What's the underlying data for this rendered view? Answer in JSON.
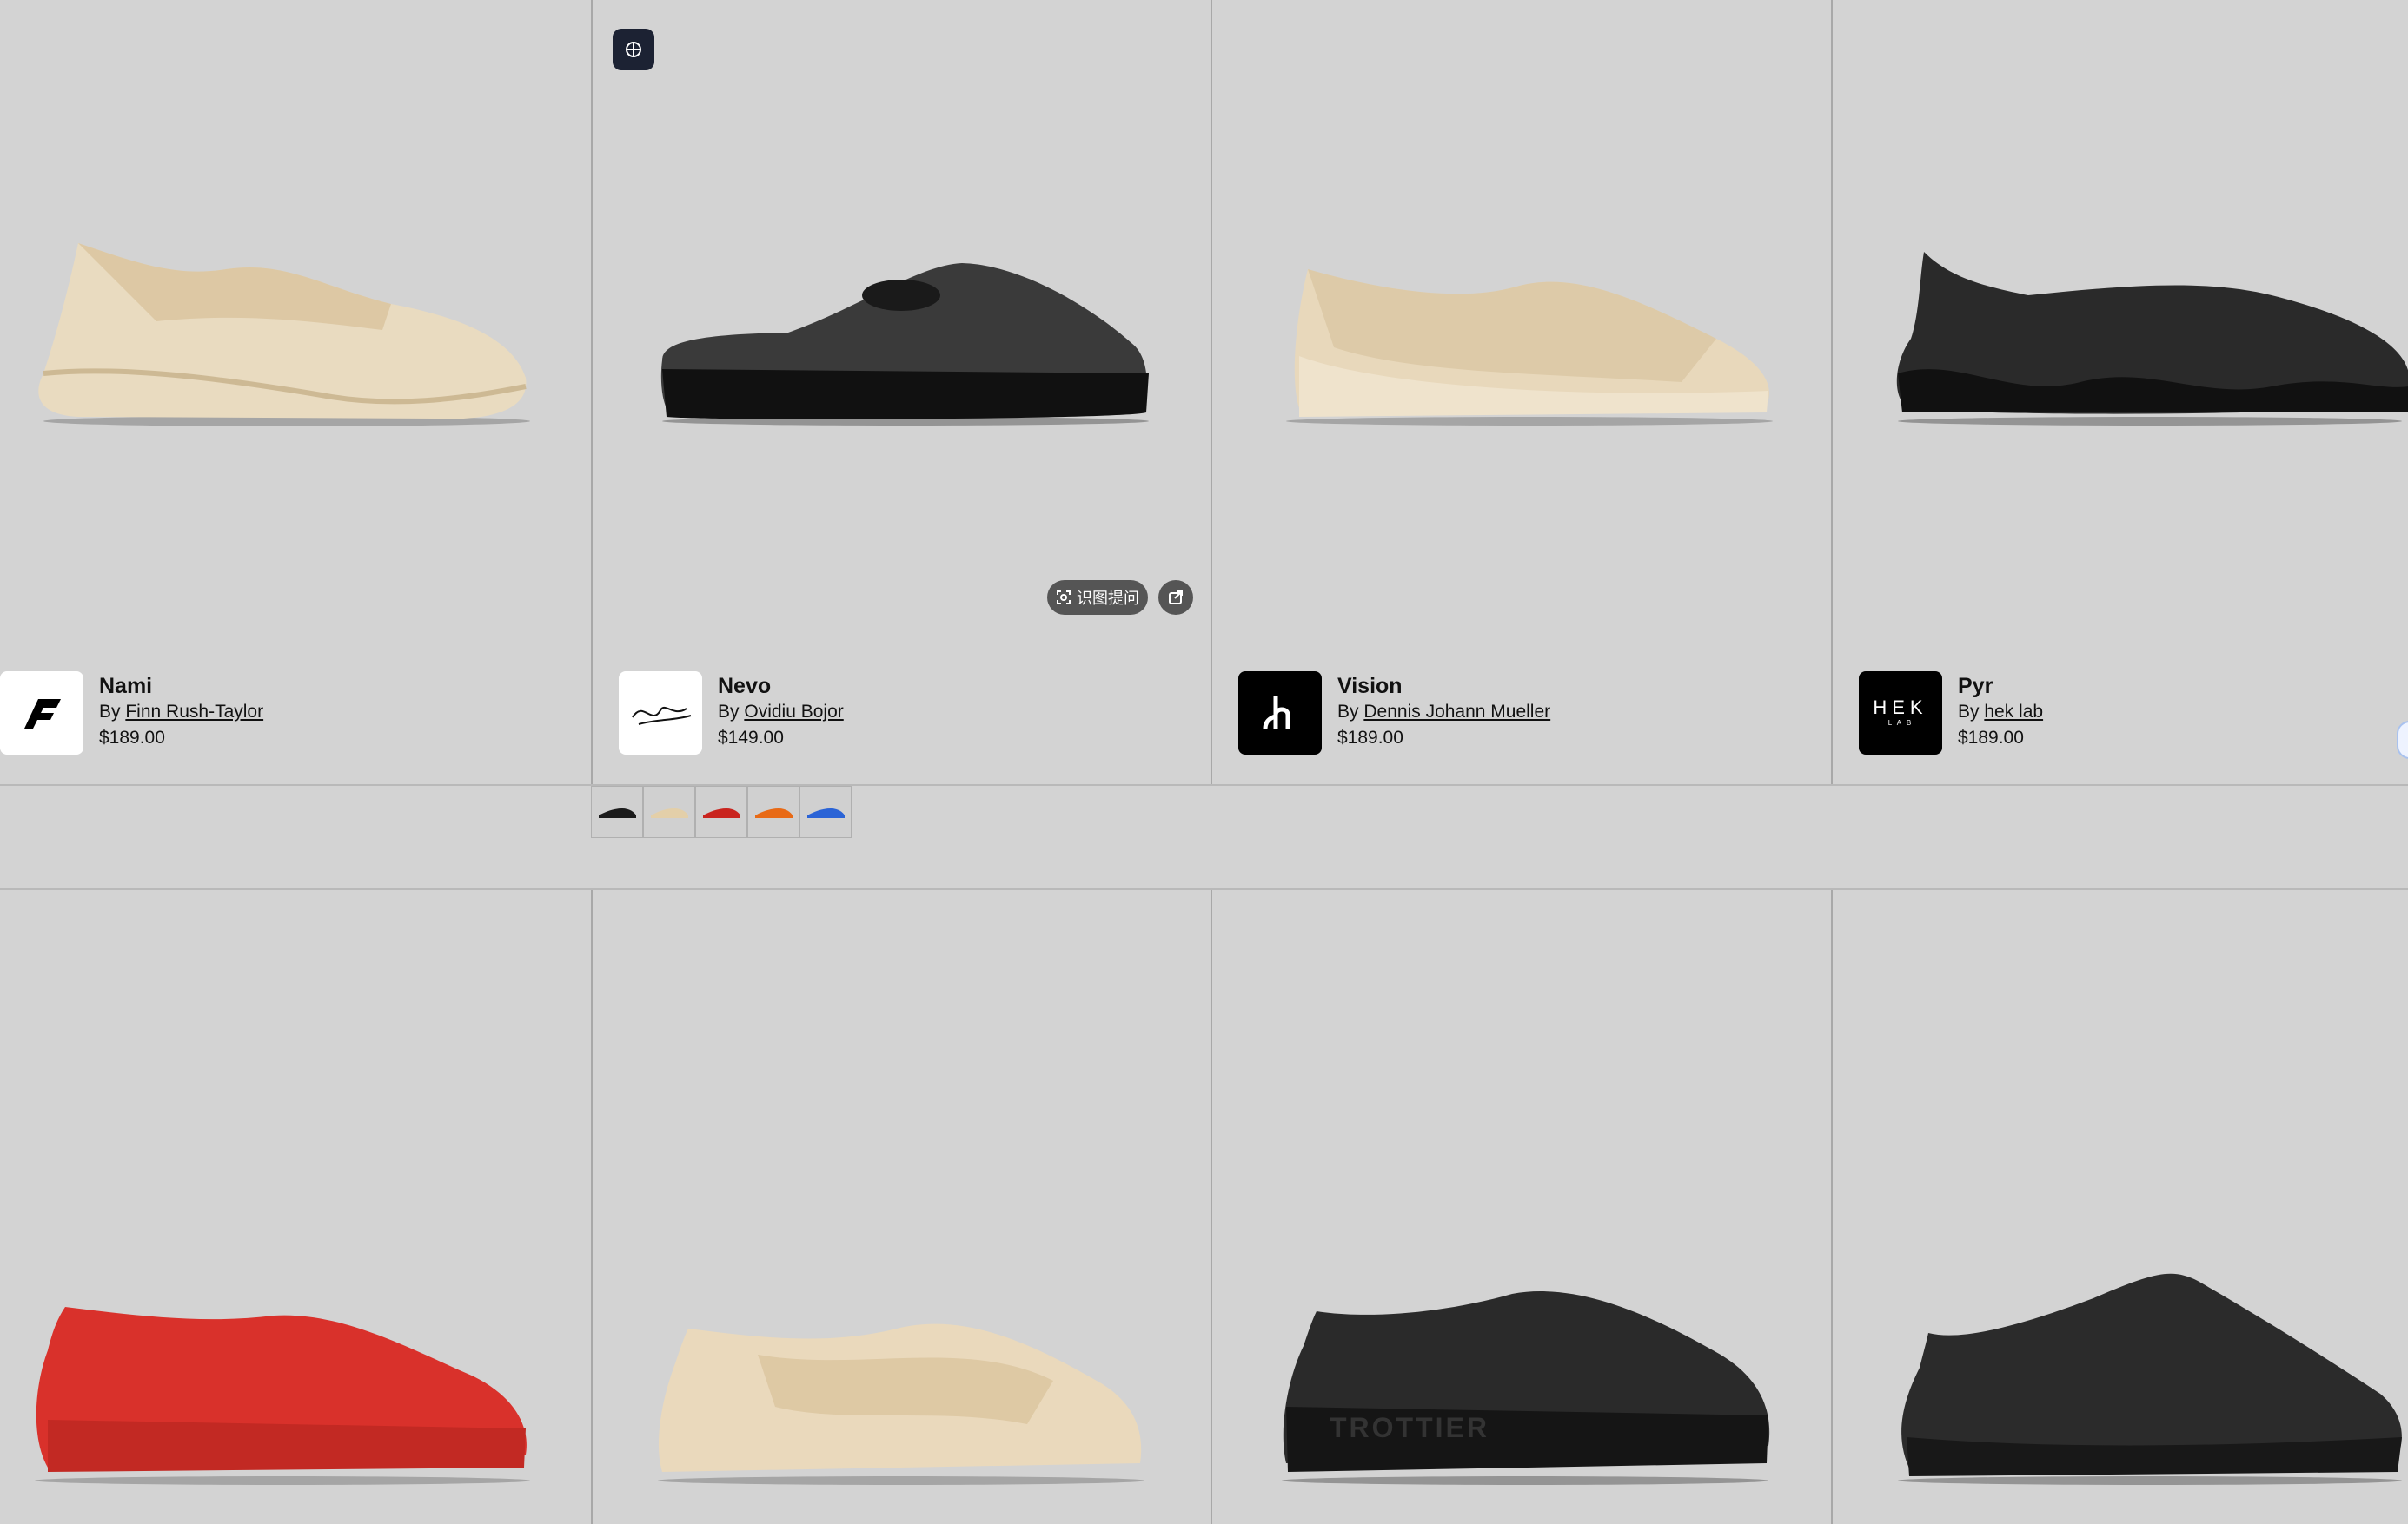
{
  "products_top": [
    {
      "name": "Nami",
      "by_prefix": "By",
      "designer": "Finn Rush-Taylor",
      "price": "$189.00",
      "logo": "f-logo-icon",
      "shoe_color": "#e9dbc0"
    },
    {
      "name": "Nevo",
      "by_prefix": "By",
      "designer": "Ovidiu Bojor",
      "price": "$149.00",
      "logo": "signature-logo-icon",
      "shoe_color": "#1a1a1a"
    },
    {
      "name": "Vision",
      "by_prefix": "By",
      "designer": "Dennis Johann Mueller",
      "price": "$189.00",
      "logo": "dh-logo-icon",
      "shoe_color": "#e8d8bb"
    },
    {
      "name": "Pyr",
      "by_prefix": "By",
      "designer": "hek lab",
      "price": "$189.00",
      "logo": "hek-lab-logo-icon",
      "logo_text": "HEK",
      "logo_sub": "L A B",
      "shoe_color": "#1e1e1e"
    }
  ],
  "products_bottom": [
    {
      "shoe_color": "#d9312b"
    },
    {
      "shoe_color": "#ead9bc"
    },
    {
      "shoe_color": "#222222",
      "print": "TROTTIER"
    },
    {
      "shoe_color": "#262626"
    }
  ],
  "swatch_colors": [
    "#1b1b1b",
    "#e3cfa9",
    "#c9241e",
    "#e86a16",
    "#2a63d6"
  ],
  "overlay": {
    "ask_label": "识图提问"
  },
  "colors": {
    "background": "#d3d3d3",
    "divider": "#a8a8a8"
  }
}
